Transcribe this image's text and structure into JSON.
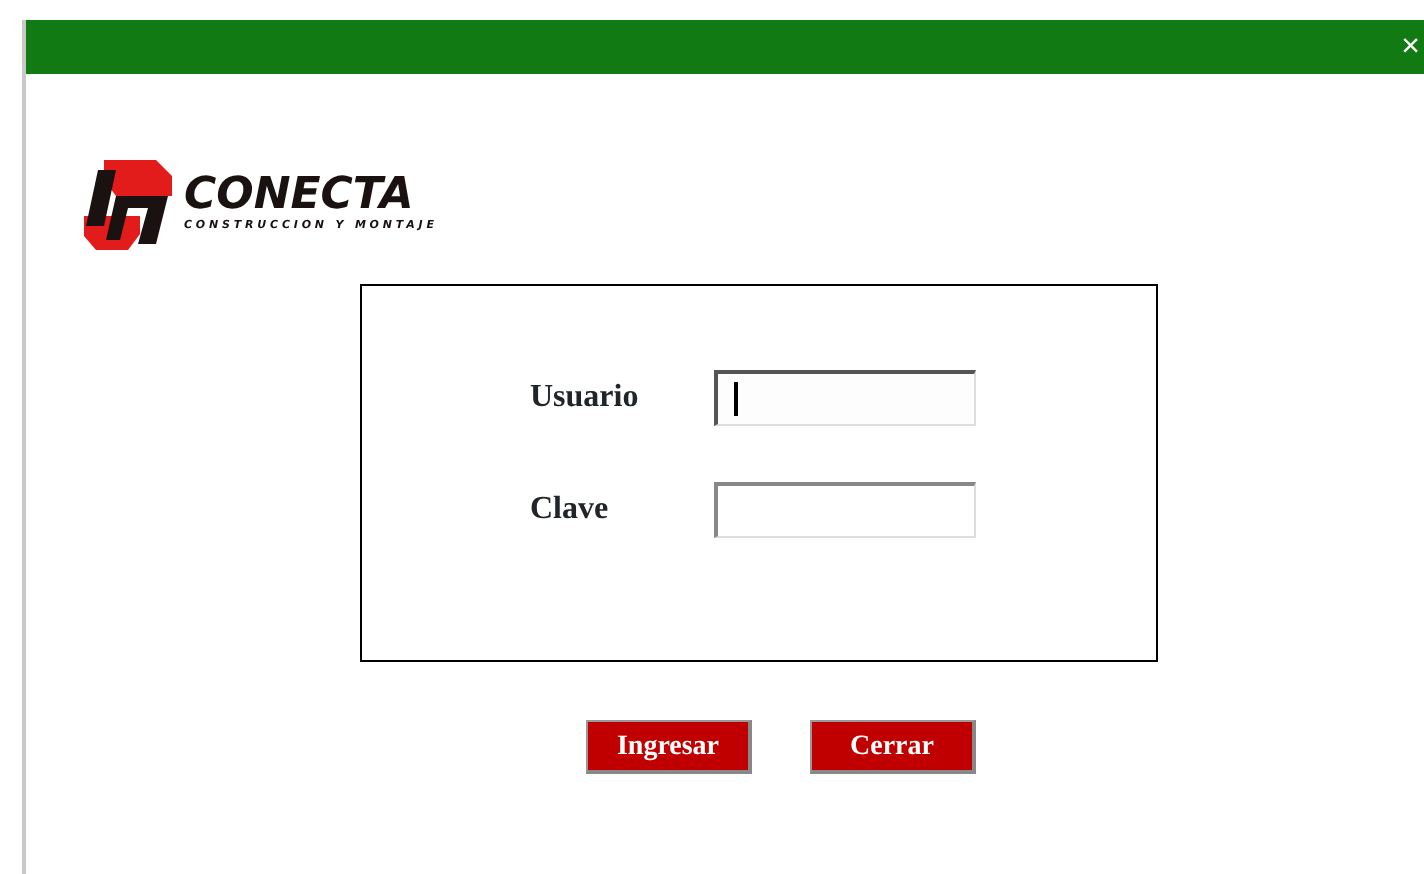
{
  "window": {
    "close": "×"
  },
  "logo": {
    "name": "CONECTA",
    "tagline": "CONSTRUCCION Y MONTAJE"
  },
  "form": {
    "fields": [
      {
        "label": "Usuario",
        "focused": true
      },
      {
        "label": "Clave",
        "focused": false
      }
    ]
  },
  "buttons": [
    "Ingresar",
    "Cerrar"
  ]
}
